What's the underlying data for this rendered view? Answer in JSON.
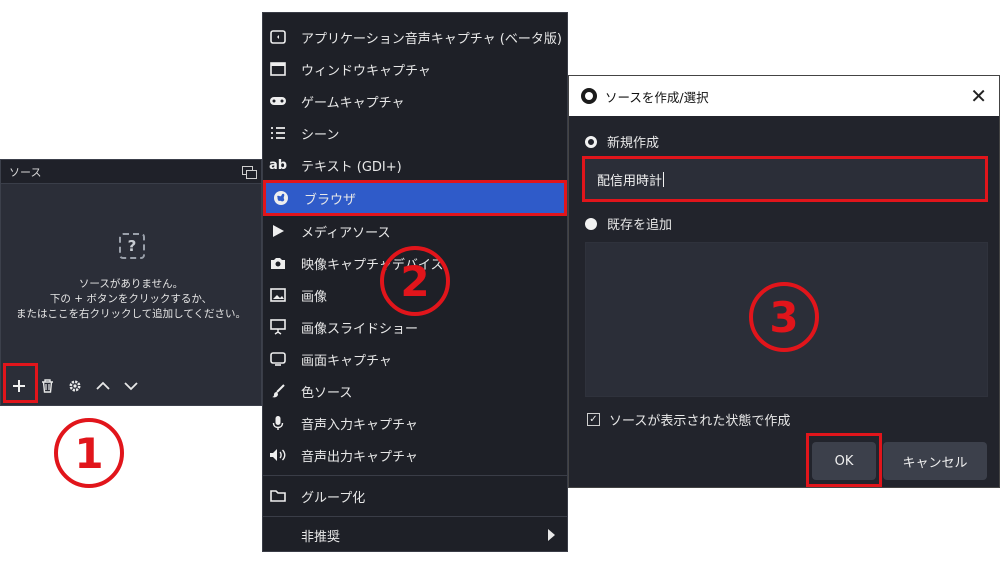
{
  "sources_dock": {
    "title": "ソース",
    "empty_icon_glyph": "?",
    "empty_line1": "ソースがありません。",
    "empty_line2": "下の + ボタンをクリックするか、",
    "empty_line3": "またはここを右クリックして追加してください。",
    "toolbar_icons": [
      "add-icon",
      "trash-icon",
      "gear-icon",
      "chevron-up-icon",
      "chevron-down-icon"
    ]
  },
  "add_menu": {
    "items": [
      {
        "label": "アプリケーション音声キャプチャ (ベータ版)",
        "icon": "app-audio-icon"
      },
      {
        "label": "ウィンドウキャプチャ",
        "icon": "window-icon"
      },
      {
        "label": "ゲームキャプチャ",
        "icon": "gamepad-icon"
      },
      {
        "label": "シーン",
        "icon": "list-icon"
      },
      {
        "label": "テキスト (GDI+)",
        "icon": "text-icon",
        "glyph": "ab"
      },
      {
        "label": "ブラウザ",
        "icon": "globe-icon",
        "selected": true
      },
      {
        "label": "メディアソース",
        "icon": "play-icon"
      },
      {
        "label": "映像キャプチャデバイス",
        "icon": "camera-icon"
      },
      {
        "label": "画像",
        "icon": "image-icon"
      },
      {
        "label": "画像スライドショー",
        "icon": "slideshow-icon"
      },
      {
        "label": "画面キャプチャ",
        "icon": "monitor-icon"
      },
      {
        "label": "色ソース",
        "icon": "brush-icon"
      },
      {
        "label": "音声入力キャプチャ",
        "icon": "microphone-icon"
      },
      {
        "label": "音声出力キャプチャ",
        "icon": "speaker-icon"
      },
      {
        "label": "グループ化",
        "icon": "folder-icon"
      },
      {
        "label": "非推奨",
        "icon": "submenu-arrow-icon"
      }
    ],
    "accent_color": "#2f5bc9"
  },
  "dialog": {
    "title": "ソースを作成/選択",
    "close_glyph": "✕",
    "new_label": "新規作成",
    "name_value": "配信用時計",
    "existing_label": "既存を追加",
    "visible_label": "ソースが表示された状態で作成",
    "visible_checked": true,
    "check_glyph": "✓",
    "ok_label": "OK",
    "cancel_label": "キャンセル"
  },
  "steps": {
    "step1": "1",
    "step2": "2",
    "step3": "3",
    "color": "#e1151b"
  }
}
